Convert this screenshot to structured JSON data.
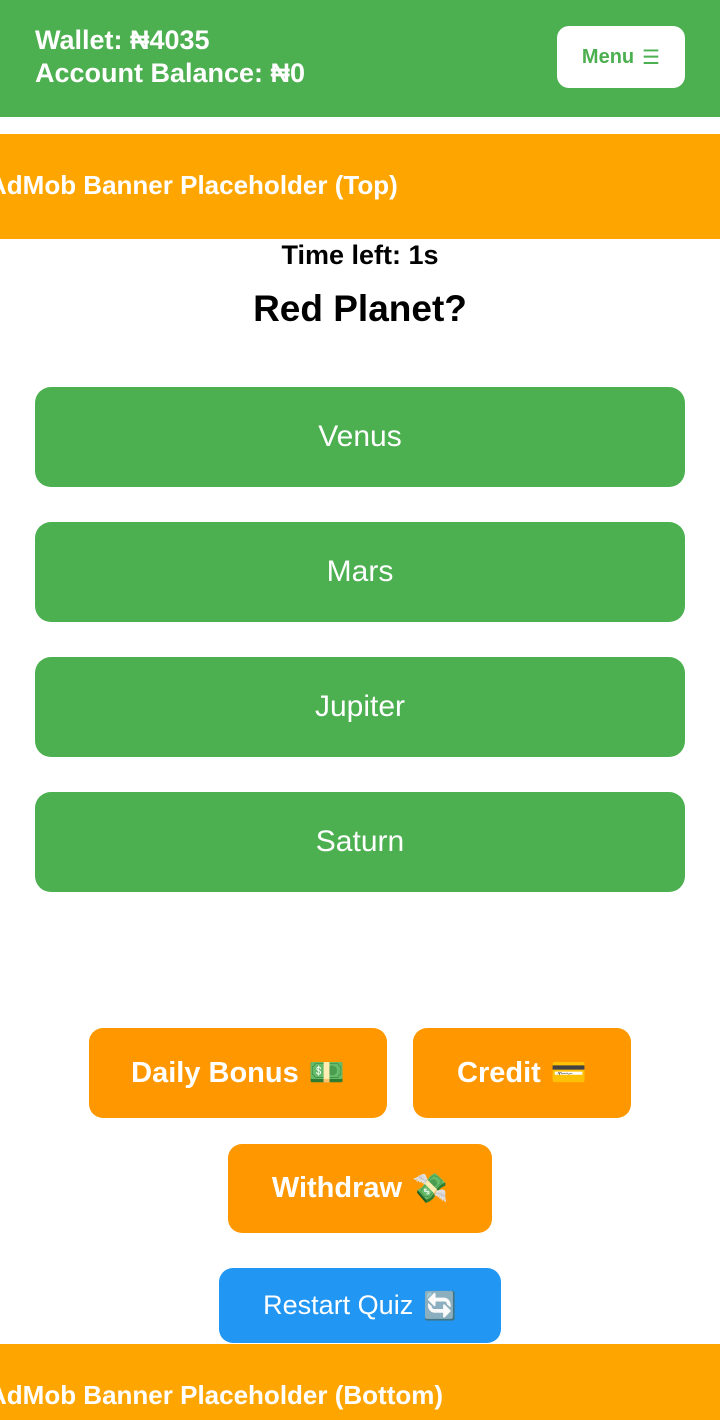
{
  "header": {
    "wallet_text": "Wallet: ₦4035",
    "balance_text": "Account Balance: ₦0",
    "menu_label": "Menu",
    "menu_icon": "☰"
  },
  "banners": {
    "top": "AdMob Banner Placeholder (Top)",
    "bottom": "AdMob Banner Placeholder (Bottom)"
  },
  "quiz": {
    "timer": "Time left: 1s",
    "question": "Red Planet?",
    "options": [
      "Venus",
      "Mars",
      "Jupiter",
      "Saturn"
    ]
  },
  "actions": {
    "daily_bonus_label": "Daily Bonus",
    "daily_bonus_icon": "💵",
    "credit_label": "Credit",
    "credit_icon": "💳",
    "withdraw_label": "Withdraw",
    "withdraw_icon": "💸",
    "restart_label": "Restart Quiz",
    "restart_icon": "🔄"
  },
  "colors": {
    "header": "#4caf50",
    "banner": "#ffa500",
    "answer": "#4caf50",
    "action": "#ff9800",
    "restart": "#2196f3"
  }
}
